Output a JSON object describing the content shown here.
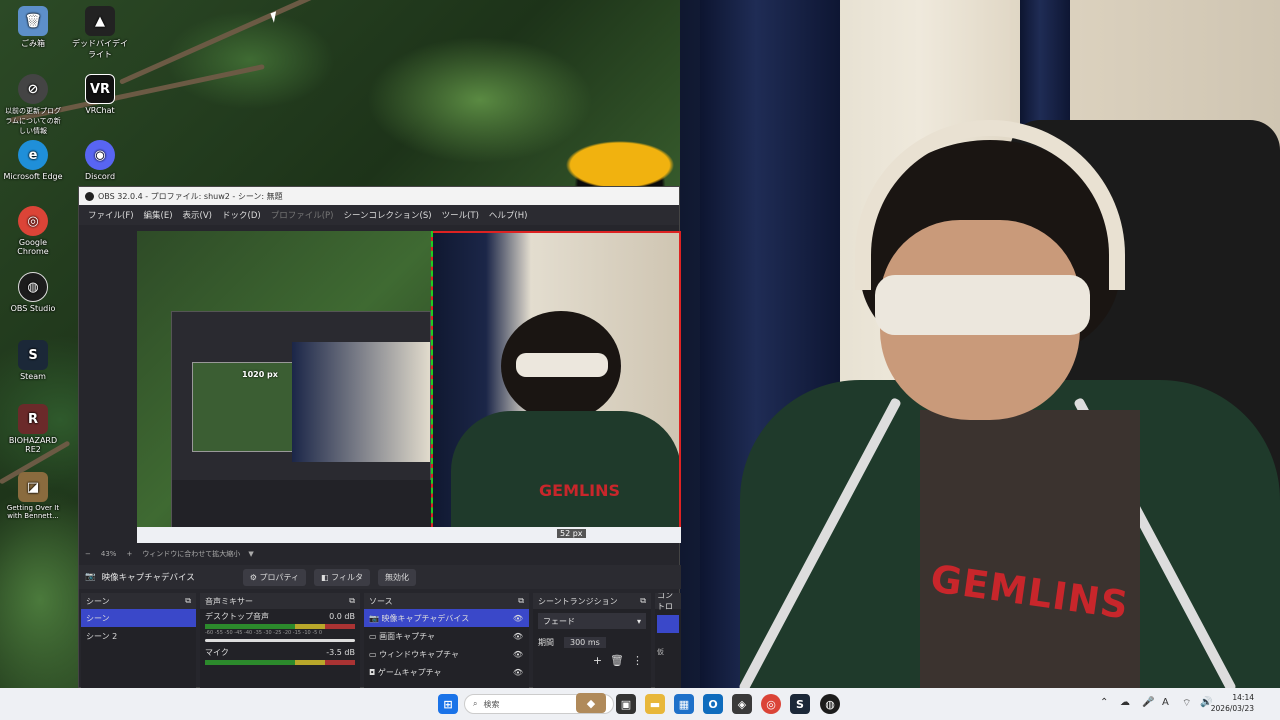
{
  "desktop": {
    "icons": [
      {
        "label": "ごみ箱",
        "glyph": "🗑",
        "color": "#5d8fc9"
      },
      {
        "label": "デッドバイデイライト",
        "glyph": "▲",
        "color": "#222"
      },
      {
        "label": "以前の更新プログラムについての新しい情報",
        "glyph": "⊘",
        "color": "#444"
      },
      {
        "label": "VRChat",
        "glyph": "VR",
        "color": "#111"
      },
      {
        "label": "Microsoft Edge",
        "glyph": "e",
        "color": "#1f8fd9"
      },
      {
        "label": "Discord",
        "glyph": "◉",
        "color": "#5865f2"
      },
      {
        "label": "Google Chrome",
        "glyph": "◎",
        "color": "#db4437"
      },
      {
        "label": "OBS Studio",
        "glyph": "◍",
        "color": "#1c1c1c"
      },
      {
        "label": "Steam",
        "glyph": "S",
        "color": "#1b2838"
      },
      {
        "label": "BIOHAZARD RE2",
        "glyph": "R",
        "color": "#6b2a2a"
      },
      {
        "label": "Getting Over It with Bennett...",
        "glyph": "◪",
        "color": "#8a6b3e"
      }
    ]
  },
  "obs": {
    "title": "OBS 32.0.4 - プロファイル: shuw2 - シーン: 無題",
    "menu": [
      "ファイル(F)",
      "編集(E)",
      "表示(V)",
      "ドック(D)",
      "プロファイル(P)",
      "シーンコレクション(S)",
      "ツール(T)",
      "ヘルプ(H)"
    ],
    "preview": {
      "size_label": "1020 px",
      "size_label_2": "52 px"
    },
    "zoom": {
      "minus": "−",
      "value": "43%",
      "plus": "+",
      "mode": "ウィンドウに合わせて拡大縮小"
    },
    "source_bar": {
      "name": "映像キャプチャデバイス",
      "properties": "プロパティ",
      "filters": "フィルタ",
      "disable": "無効化"
    },
    "docks": {
      "scenes": {
        "title": "シーン",
        "items": [
          "シーン",
          "シーン 2"
        ]
      },
      "mixer": {
        "title": "音声ミキサー",
        "channels": [
          {
            "name": "デスクトップ音声",
            "db": "0.0 dB"
          },
          {
            "name": "マイク",
            "db": "-3.5 dB"
          }
        ],
        "scale": "-60 -55 -50 -45 -40 -35 -30 -25 -20 -15 -10 -5 0"
      },
      "sources": {
        "title": "ソース",
        "items": [
          "映像キャプチャデバイス",
          "画面キャプチャ",
          "ウィンドウキャプチャ",
          "ゲームキャプチャ"
        ]
      },
      "transitions": {
        "title": "シーントランジション",
        "type": "フェード",
        "duration_label": "期間",
        "duration": "300 ms"
      },
      "controls": {
        "title": "コントロ",
        "item": "仮"
      }
    }
  },
  "camera": {
    "shirt_text": "GEMLINS"
  },
  "taskbar": {
    "search_placeholder": "検索",
    "time": "14:14",
    "date": "2026/03/23"
  }
}
